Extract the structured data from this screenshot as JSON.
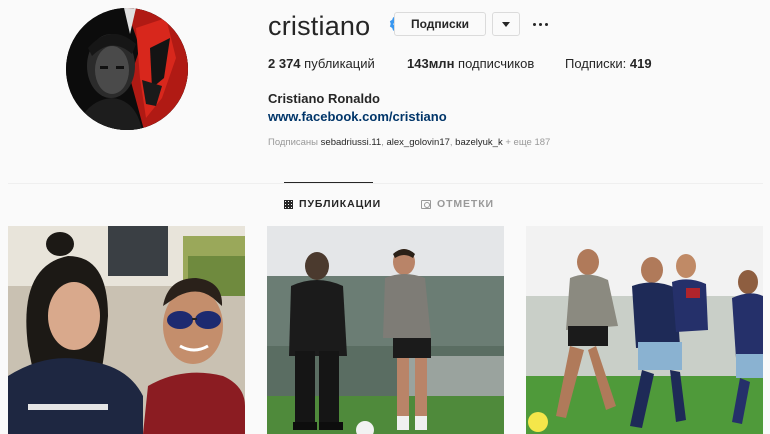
{
  "profile": {
    "username": "cristiano",
    "verified": true,
    "full_name": "Cristiano Ronaldo",
    "website": "www.facebook.com/cristiano"
  },
  "actions": {
    "subscribed_label": "Подписки",
    "dropdown_icon": "chevron-down-icon",
    "more_icon": "more-options-icon"
  },
  "stats": {
    "posts_count": "2 374",
    "posts_label": "публикаций",
    "followers_count": "143млн",
    "followers_label": "подписчиков",
    "following_label": "Подписки:",
    "following_count": "419"
  },
  "followed_by": {
    "prefix": "Подписаны",
    "users": [
      "sebadriussi.11",
      "alex_golovin17",
      "bazelyuk_k"
    ],
    "suffix": "+ еще 187"
  },
  "tabs": [
    {
      "label": "ПУБЛИКАЦИИ",
      "icon": "grid-icon",
      "active": true
    },
    {
      "label": "ОТМЕТКИ",
      "icon": "tagged-icon",
      "active": false
    }
  ],
  "colors": {
    "background": "#fafafa",
    "text": "#262626",
    "link": "#003569",
    "secondary": "#999999",
    "verified": "#3897f0",
    "border": "#dbdbdb"
  }
}
